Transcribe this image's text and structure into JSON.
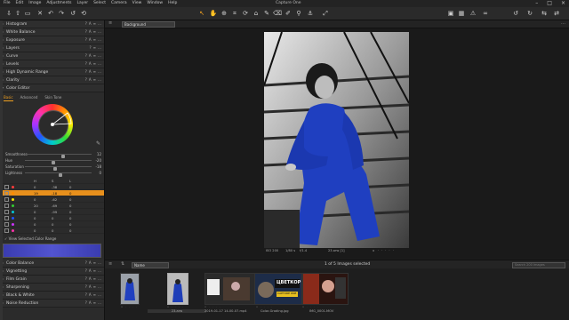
{
  "app": {
    "title": "Capture One"
  },
  "menu": [
    "File",
    "Edit",
    "Image",
    "Adjustments",
    "Layer",
    "Select",
    "Camera",
    "View",
    "Window",
    "Help"
  ],
  "toolbar": {
    "left_icons": [
      "import-icon",
      "export-icon",
      "layers-icon",
      "delete-icon",
      "undo-icon",
      "redo-icon",
      "undo-alt-icon",
      "reset-icon"
    ],
    "center_icons": [
      "cursor-icon",
      "pan-icon",
      "zoom-icon",
      "crop-icon",
      "rotate-icon",
      "keystone-icon",
      "brush-icon",
      "eraser-icon",
      "picker-icon",
      "wb-picker-icon"
    ],
    "right_icons": [
      "compare-icon",
      "grid-icon",
      "exposure-warning-icon",
      "proof-icon",
      "rotate-left-icon",
      "rotate-right-icon",
      "copy-icon",
      "paste-icon"
    ],
    "expand": "⤢"
  },
  "panels_top": [
    {
      "label": "Histogram",
      "icons": [
        "?",
        "A",
        "≡",
        "…"
      ]
    },
    {
      "label": "White Balance",
      "icons": [
        "?",
        "A",
        "≡",
        "…"
      ]
    },
    {
      "label": "Exposure",
      "icons": [
        "?",
        "A",
        "≡",
        "…"
      ]
    },
    {
      "label": "Layers",
      "icons": [
        "?",
        "≡",
        "…"
      ]
    },
    {
      "label": "Curve",
      "icons": [
        "?",
        "A",
        "≡",
        "…"
      ]
    },
    {
      "label": "Levels",
      "icons": [
        "?",
        "A",
        "≡",
        "…"
      ]
    },
    {
      "label": "High Dynamic Range",
      "icons": [
        "?",
        "A",
        "≡",
        "…"
      ]
    },
    {
      "label": "Clarity",
      "icons": [
        "?",
        "A",
        "≡",
        "…"
      ]
    }
  ],
  "color_editor": {
    "title": "Color Editor",
    "tabs": [
      "Basic",
      "Advanced",
      "Skin Tone"
    ],
    "active_tab": "Basic",
    "sliders": [
      {
        "label": "Smoothness",
        "value": "12",
        "pos": 0.55
      },
      {
        "label": "Hue",
        "value": "-20",
        "pos": 0.4
      },
      {
        "label": "Saturation",
        "value": "-18",
        "pos": 0.42
      },
      {
        "label": "Lightness",
        "value": "0",
        "pos": 0.5
      }
    ],
    "table_headers": [
      "H",
      "S",
      "L"
    ],
    "rows": [
      {
        "color": "#ff3b3b",
        "h": "0",
        "s": "-38",
        "l": "0",
        "sel": false
      },
      {
        "color": "#ff8c00",
        "h": "19",
        "s": "-18",
        "l": "0",
        "sel": true
      },
      {
        "color": "#ffe600",
        "h": "0",
        "s": "-62",
        "l": "0",
        "sel": false
      },
      {
        "color": "#33cc33",
        "h": "20",
        "s": "-69",
        "l": "0",
        "sel": false
      },
      {
        "color": "#00c8d6",
        "h": "0",
        "s": "-99",
        "l": "0",
        "sel": false
      },
      {
        "color": "#2255ff",
        "h": "0",
        "s": "0",
        "l": "0",
        "sel": false
      },
      {
        "color": "#cc33ff",
        "h": "0",
        "s": "0",
        "l": "0",
        "sel": false
      },
      {
        "color": "#ff33aa",
        "h": "0",
        "s": "0",
        "l": "0",
        "sel": false
      }
    ],
    "view_selected": "View Selected Color Range"
  },
  "panels_bottom": [
    {
      "label": "Color Balance",
      "icons": [
        "?",
        "A",
        "≡",
        "…"
      ]
    },
    {
      "label": "Vignetting",
      "icons": [
        "?",
        "A",
        "≡",
        "…"
      ]
    },
    {
      "label": "Film Grain",
      "icons": [
        "?",
        "A",
        "≡",
        "…"
      ]
    },
    {
      "label": "Sharpening",
      "icons": [
        "?",
        "A",
        "≡",
        "…"
      ]
    },
    {
      "label": "Black & White",
      "icons": [
        "?",
        "A",
        "≡",
        "…"
      ]
    },
    {
      "label": "Noise Reduction",
      "icons": [
        "?",
        "A",
        "≡",
        "…"
      ]
    }
  ],
  "viewer": {
    "background_select": "Background",
    "meta": {
      "iso": "ISO 200",
      "shutter": "1/80 s",
      "aperture": "f/1.4",
      "filename": "23.arw [1]"
    }
  },
  "filmstrip": {
    "sort_select": "Name",
    "count": "1 of 5 Images selected",
    "search_placeholder": "Search 200 Images",
    "items": [
      {
        "name": "",
        "thumb": "blue-woman"
      },
      {
        "name": "23.arw",
        "thumb": "bw-woman",
        "sel": true
      },
      {
        "name": "2019-01-17 14-00-07.mp4",
        "thumb": "video"
      },
      {
        "name": "Color-Grading.jpg",
        "thumb": "promo"
      },
      {
        "name": "IMG_0001.MOV",
        "thumb": "video-red"
      }
    ],
    "promo_text": "ЦВЕТКОР",
    "promo_sub": "CAPTURE ONE"
  }
}
